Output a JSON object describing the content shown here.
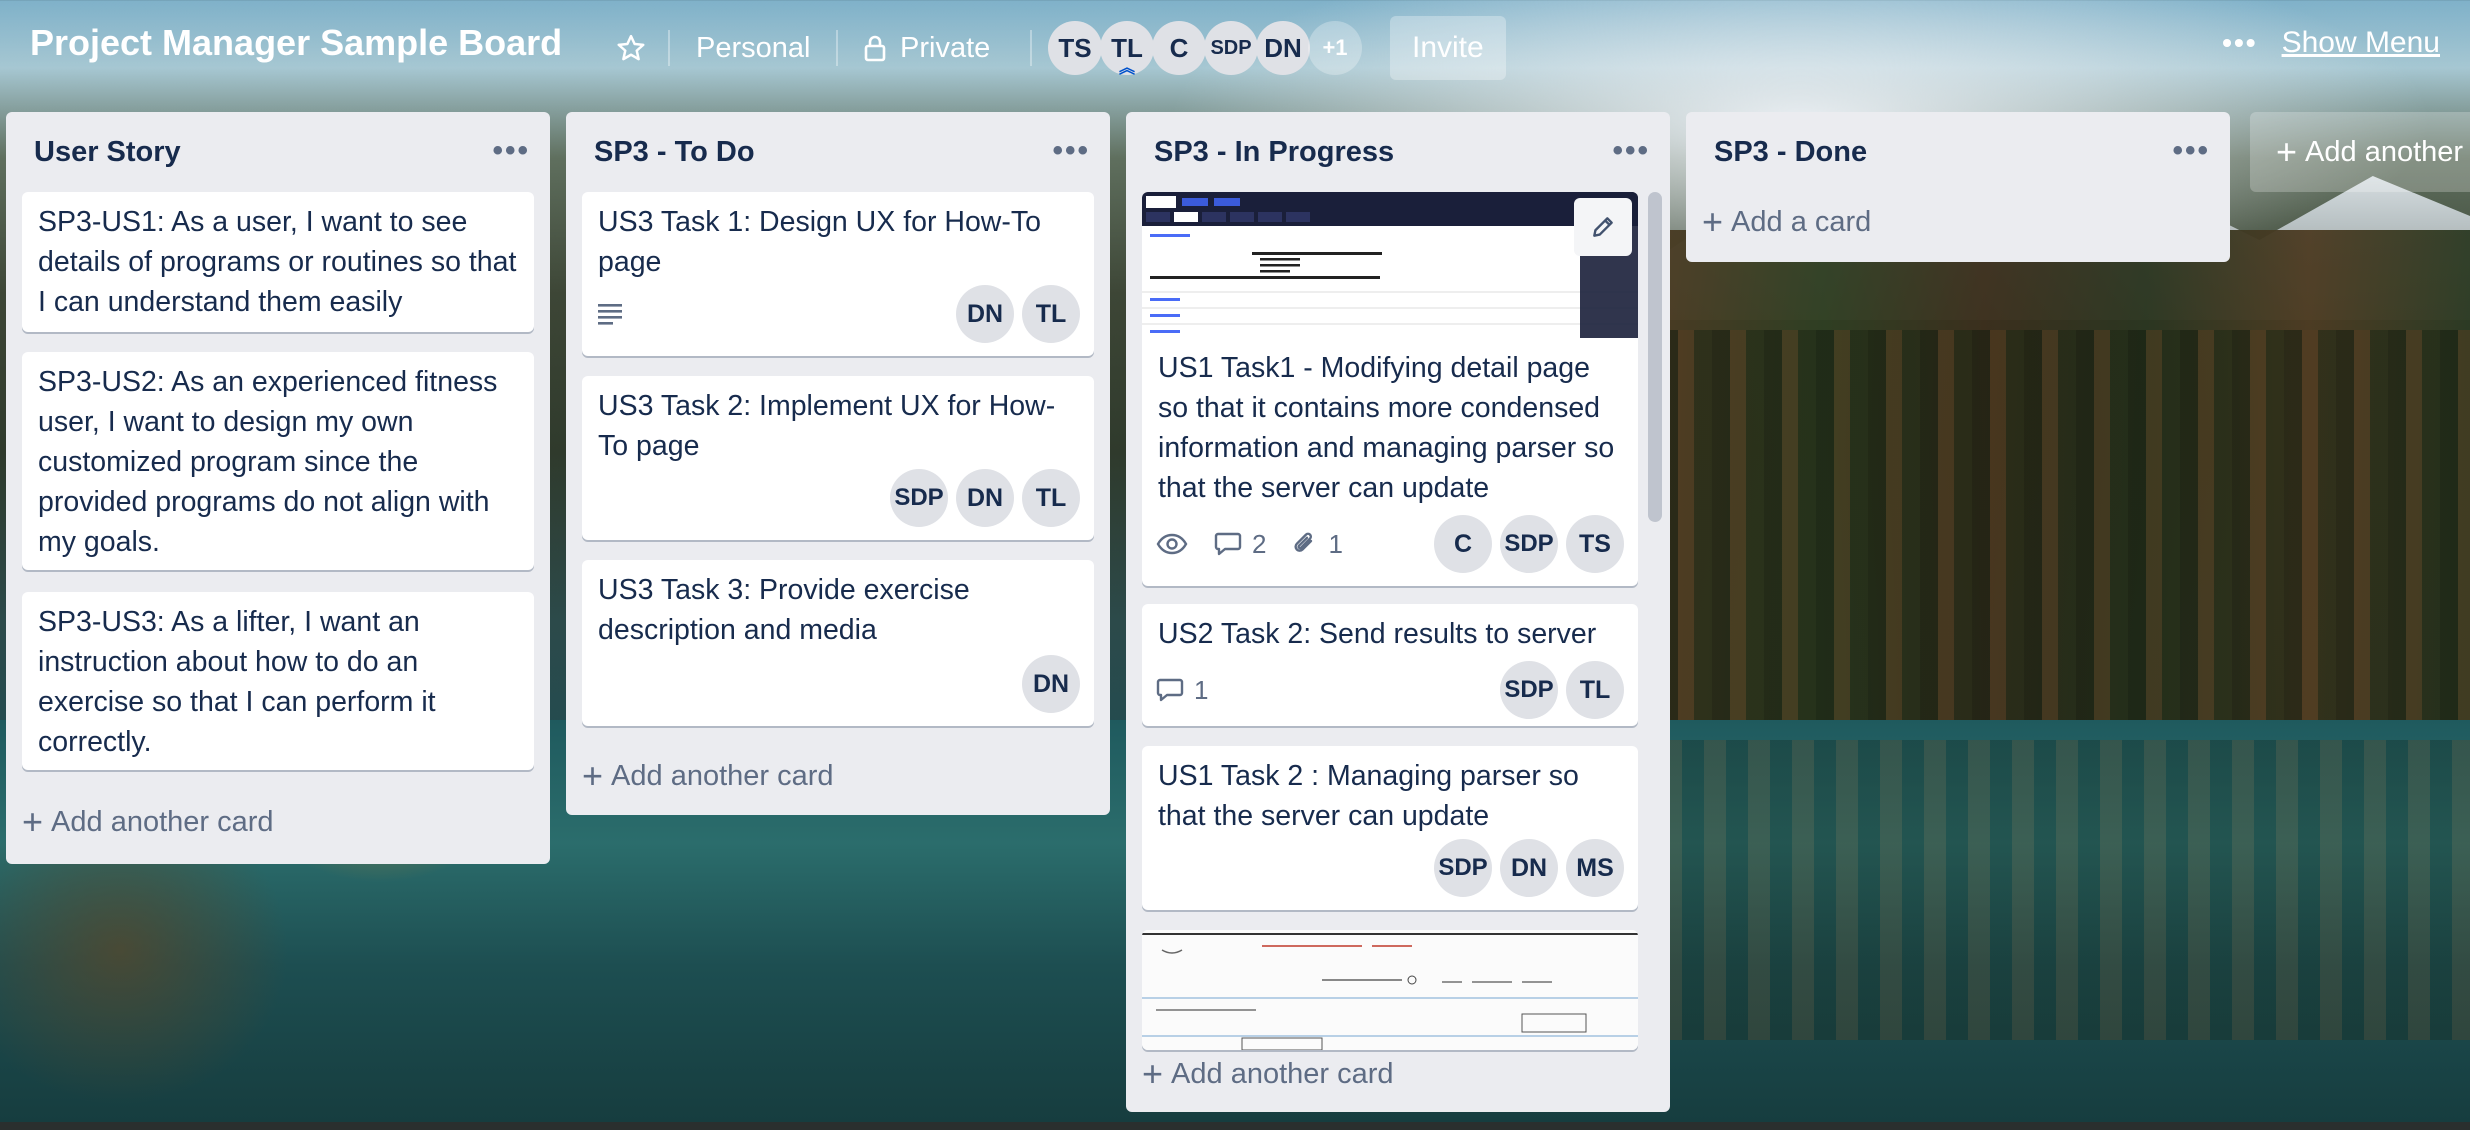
{
  "header": {
    "board_title": "Project Manager Sample Board",
    "star_icon": "star-icon",
    "workspace": "Personal",
    "visibility": "Private",
    "members": [
      "TS",
      "TL",
      "C",
      "SDP",
      "DN"
    ],
    "more_members": "+1",
    "invite_label": "Invite",
    "show_menu_label": "Show Menu"
  },
  "lists": [
    {
      "title": "User Story",
      "cards": [
        {
          "text": "SP3-US1: As a user, I want to see details of programs or routines so that I can understand them easily"
        },
        {
          "text": "SP3-US2: As an experienced fitness user, I want to design my own customized program since the provided programs do not align with my goals."
        },
        {
          "text": "SP3-US3: As a lifter, I want an instruction about how to do an exercise so that I can perform it correctly."
        }
      ],
      "add_card": "Add another card"
    },
    {
      "title": "SP3 - To Do",
      "cards": [
        {
          "text": "US3 Task 1: Design UX for How-To page",
          "members": [
            "DN",
            "TL"
          ],
          "has_description": true
        },
        {
          "text": "US3 Task 2: Implement UX for How-To page",
          "members": [
            "SDP",
            "DN",
            "TL"
          ]
        },
        {
          "text": "US3 Task 3: Provide exercise description and media",
          "members": [
            "DN"
          ]
        }
      ],
      "add_card": "Add another card"
    },
    {
      "title": "SP3 - In Progress",
      "cards": [
        {
          "text": "US1 Task1 - Modifying detail page so that it contains more condensed information and managing parser so that the server can update",
          "comments": "2",
          "attachments": "1",
          "members": [
            "C",
            "SDP",
            "TS"
          ],
          "has_cover": true
        },
        {
          "text": "US2 Task 2: Send results to server",
          "comments": "1",
          "members": [
            "SDP",
            "TL"
          ]
        },
        {
          "text": "US1 Task 2 : Managing parser so that the server can update",
          "members": [
            "SDP",
            "DN",
            "MS"
          ]
        }
      ],
      "add_card": "Add another card"
    },
    {
      "title": "SP3 - Done",
      "cards": [],
      "add_card": "Add a card"
    }
  ],
  "add_list_label": "Add another list",
  "colors": {
    "list_bg": "#ebecf0",
    "card_bg": "#ffffff",
    "text": "#172b4d",
    "muted": "#5e6c84",
    "avatar_bg": "#dfe1e6"
  }
}
